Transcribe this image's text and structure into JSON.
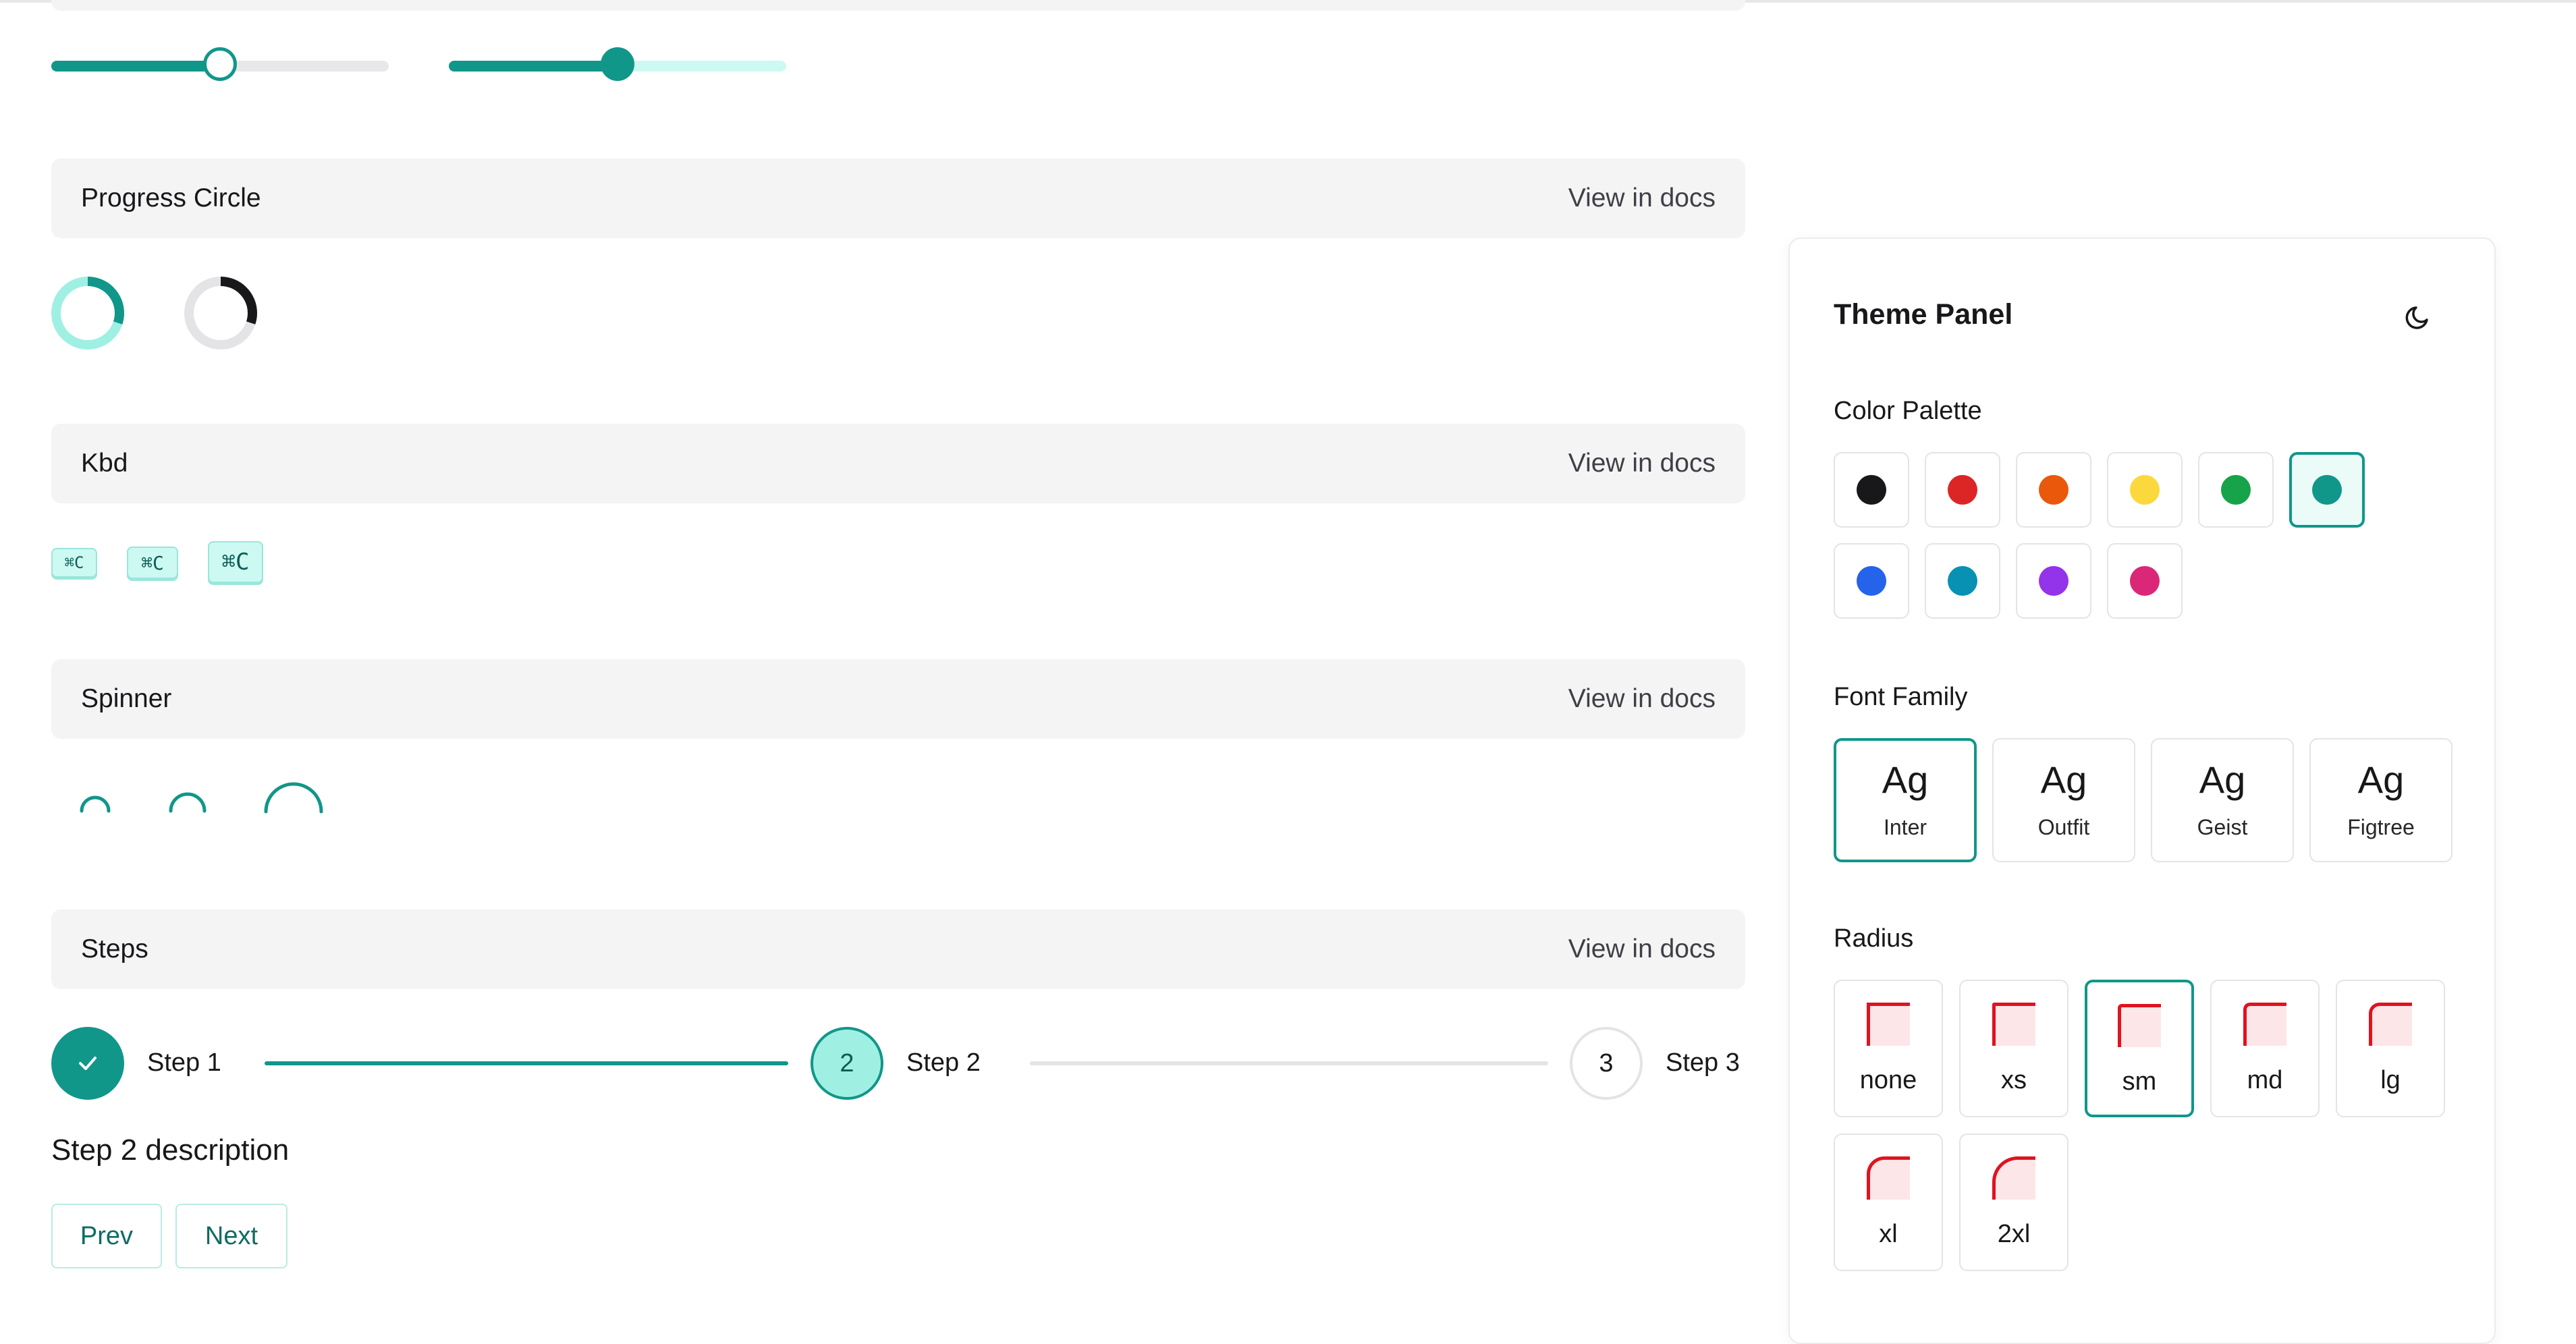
{
  "sliders": [
    {
      "name": "slider-outline-thumb",
      "value": 0.5
    },
    {
      "name": "slider-solid-thumb",
      "value": 0.5
    }
  ],
  "sections": {
    "progress_circle": {
      "title": "Progress Circle",
      "docs": "View in docs"
    },
    "kbd": {
      "title": "Kbd",
      "docs": "View in docs"
    },
    "spinner": {
      "title": "Spinner",
      "docs": "View in docs"
    },
    "steps": {
      "title": "Steps",
      "docs": "View in docs"
    }
  },
  "progress_circles": [
    {
      "value": 0.3,
      "color": "#11968a",
      "track": "#9ff0e3"
    },
    {
      "value": 0.3,
      "color": "#18181b",
      "track": "#e4e4e7"
    }
  ],
  "kbd": {
    "items": [
      "⌘C",
      "⌘C",
      "⌘C"
    ]
  },
  "steps": {
    "items": [
      {
        "number": "1",
        "label": "Step 1",
        "state": "complete"
      },
      {
        "number": "2",
        "label": "Step 2",
        "state": "current"
      },
      {
        "number": "3",
        "label": "Step 3",
        "state": "upcoming"
      }
    ],
    "description": "Step 2 description",
    "prev_label": "Prev",
    "next_label": "Next"
  },
  "theme_panel": {
    "title": "Theme Panel",
    "color_palette_label": "Color Palette",
    "colors": [
      "#18181b",
      "#dc2626",
      "#ea580c",
      "#fbd93d",
      "#16a34a",
      "#11968a",
      "#2563eb",
      "#0891b2",
      "#9333ea",
      "#db2777"
    ],
    "selected_color": 5,
    "font_family_label": "Font Family",
    "fonts": [
      {
        "sample": "Ag",
        "name": "Inter"
      },
      {
        "sample": "Ag",
        "name": "Outfit"
      },
      {
        "sample": "Ag",
        "name": "Geist"
      },
      {
        "sample": "Ag",
        "name": "Figtree"
      }
    ],
    "selected_font": "Inter",
    "radius_label": "Radius",
    "radii": [
      "none",
      "xs",
      "sm",
      "md",
      "lg",
      "xl",
      "2xl"
    ],
    "selected_radius": "sm"
  },
  "icons": {
    "theme_toggle": "moon-icon",
    "step_complete": "check-icon"
  }
}
